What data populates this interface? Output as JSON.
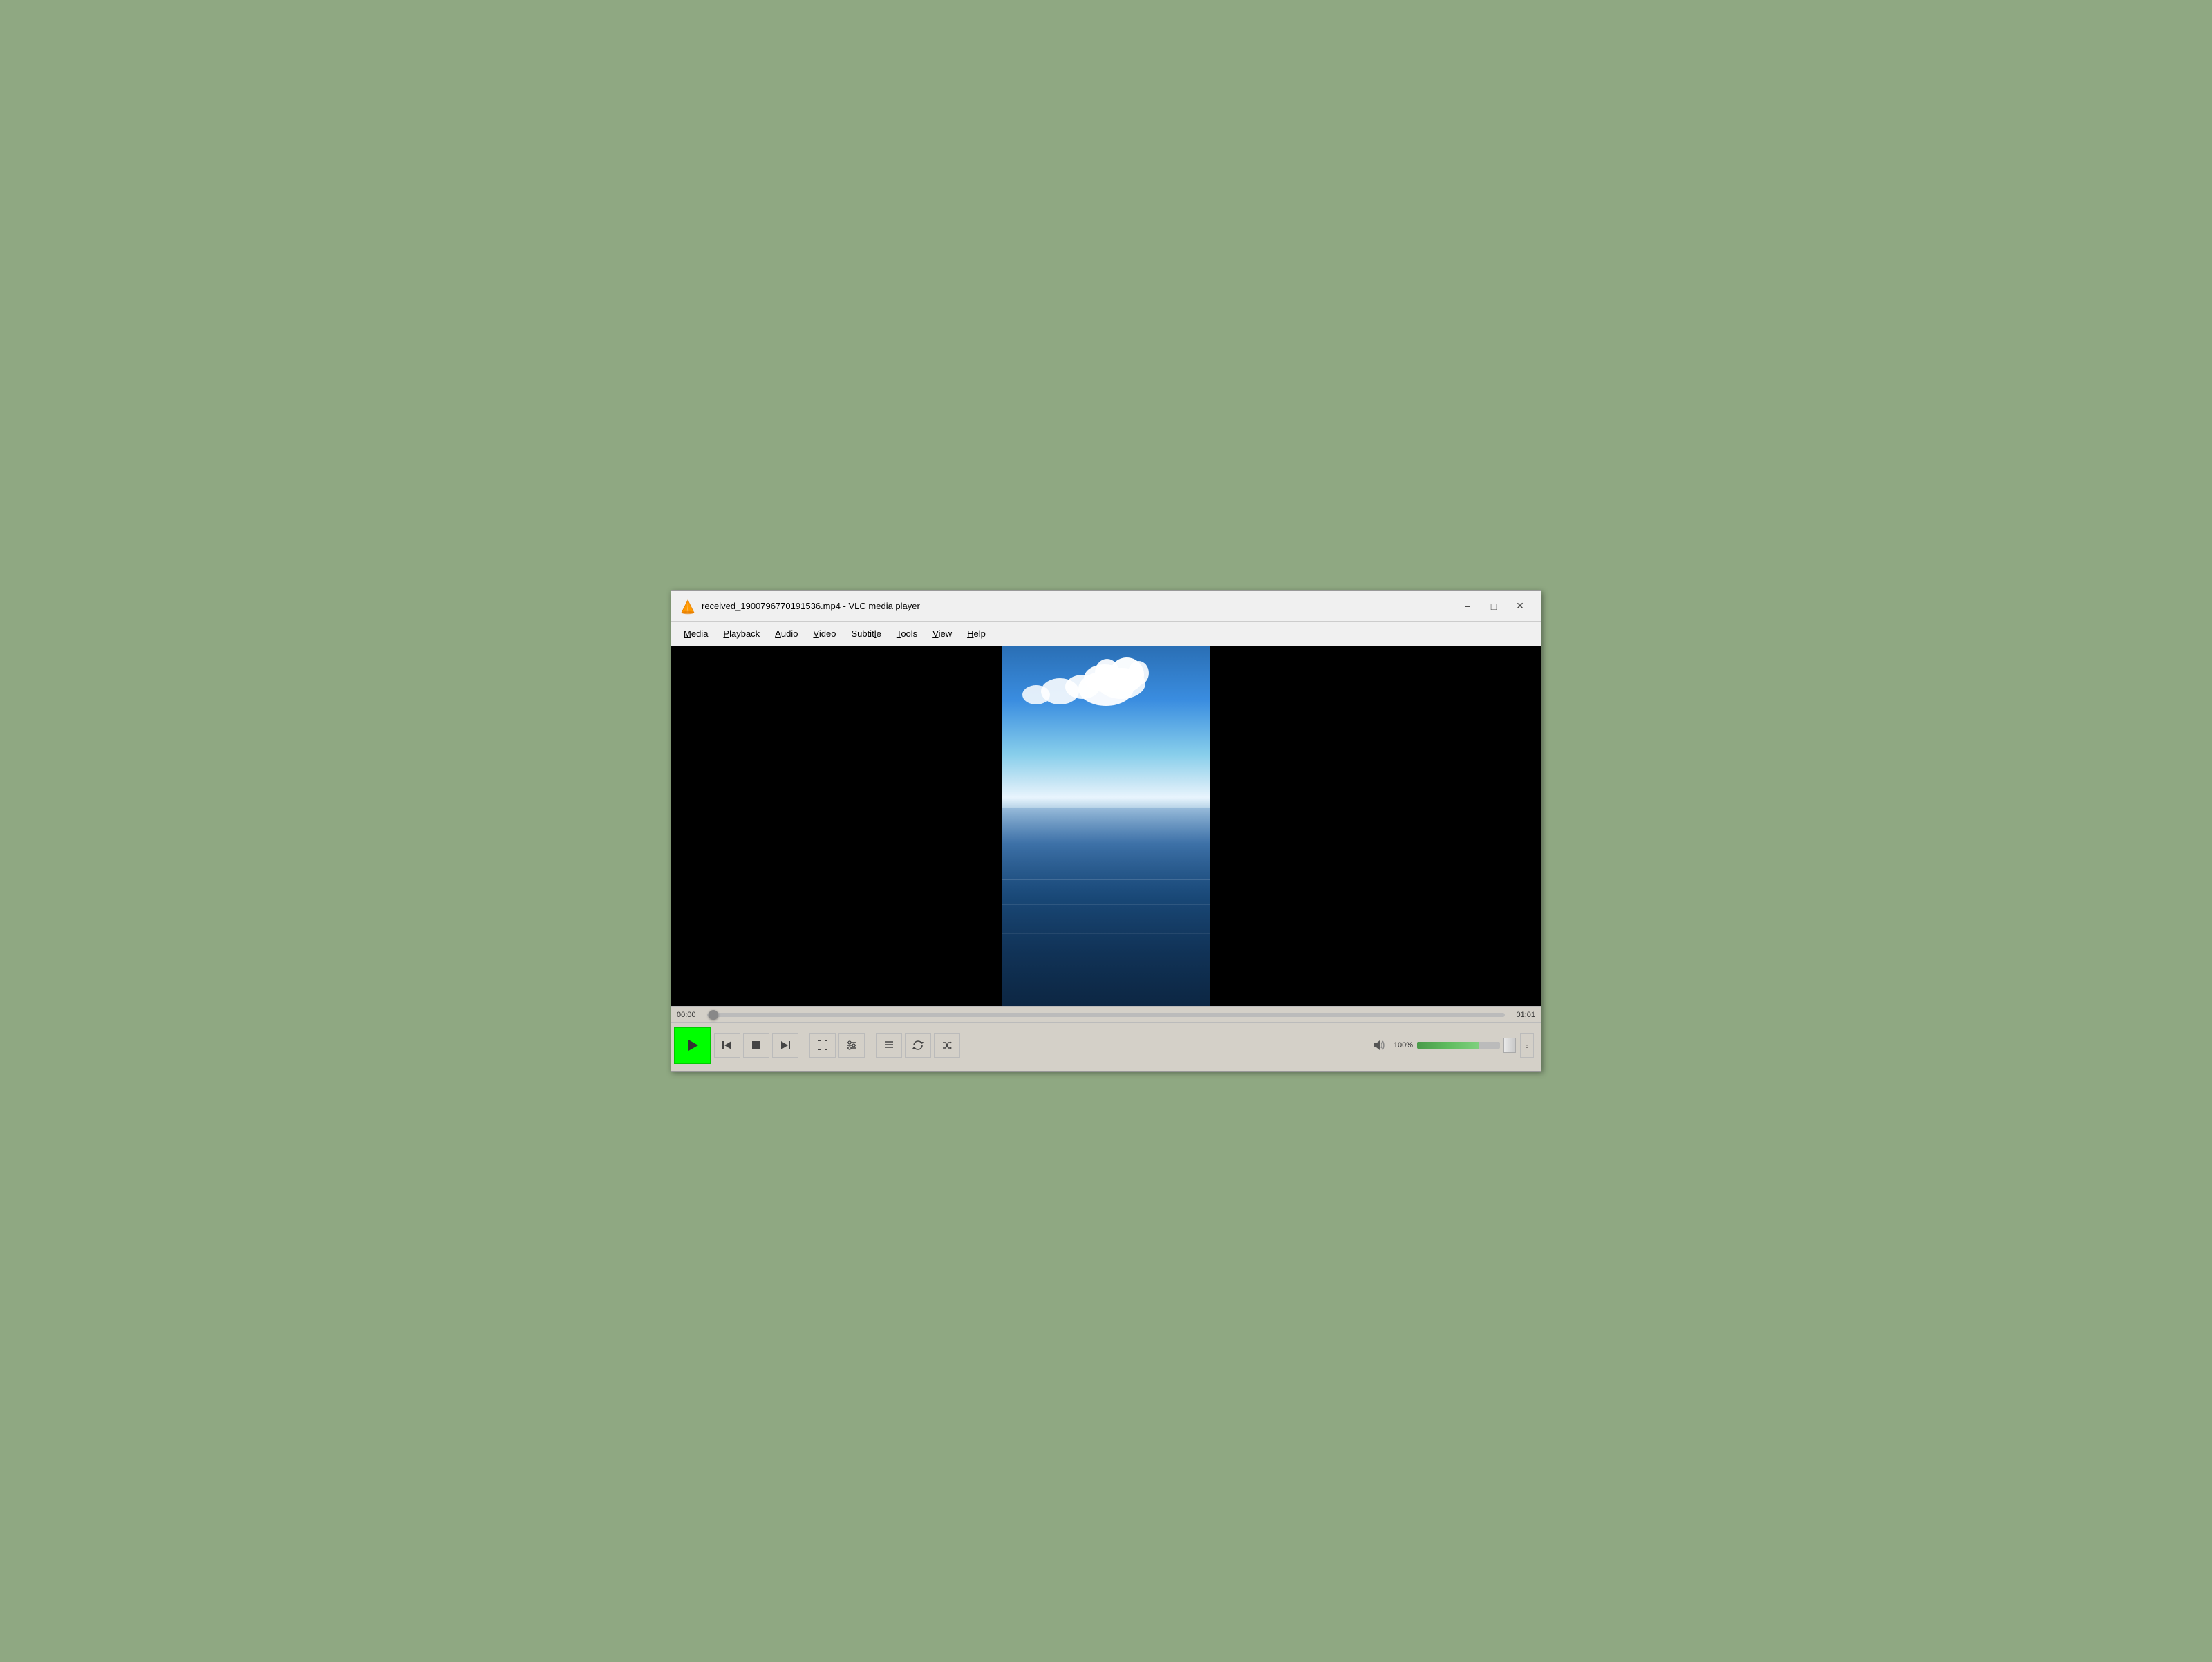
{
  "window": {
    "title": "received_19007967701915​36.mp4 - VLC media player",
    "title_short": "received_190079677019​1536.mp4 - VLC media player"
  },
  "menu": {
    "items": [
      {
        "label": "Media",
        "underline_index": 0
      },
      {
        "label": "Playback",
        "underline_index": 0
      },
      {
        "label": "Audio",
        "underline_index": 0
      },
      {
        "label": "Video",
        "underline_index": 0
      },
      {
        "label": "Subtitle",
        "underline_index": 3
      },
      {
        "label": "Tools",
        "underline_index": 0
      },
      {
        "label": "View",
        "underline_index": 0
      },
      {
        "label": "Help",
        "underline_index": 0
      }
    ]
  },
  "controls": {
    "play_label": "▶",
    "prev_label": "⏮",
    "stop_label": "■",
    "next_label": "⏭",
    "fullscreen_label": "⛶",
    "ext_settings_label": "⚙",
    "playlist_label": "☰",
    "loop_label": "↻",
    "shuffle_label": "⇄",
    "volume_pct": "100%",
    "time_start": "00:00",
    "time_end": "01:01"
  },
  "colors": {
    "play_highlight": "#00ff00",
    "volume_fill": "#5fbc5f",
    "bg_desktop": "#8fa882",
    "window_bg": "#f0f0f0",
    "controls_bg": "#d4d0c8"
  }
}
